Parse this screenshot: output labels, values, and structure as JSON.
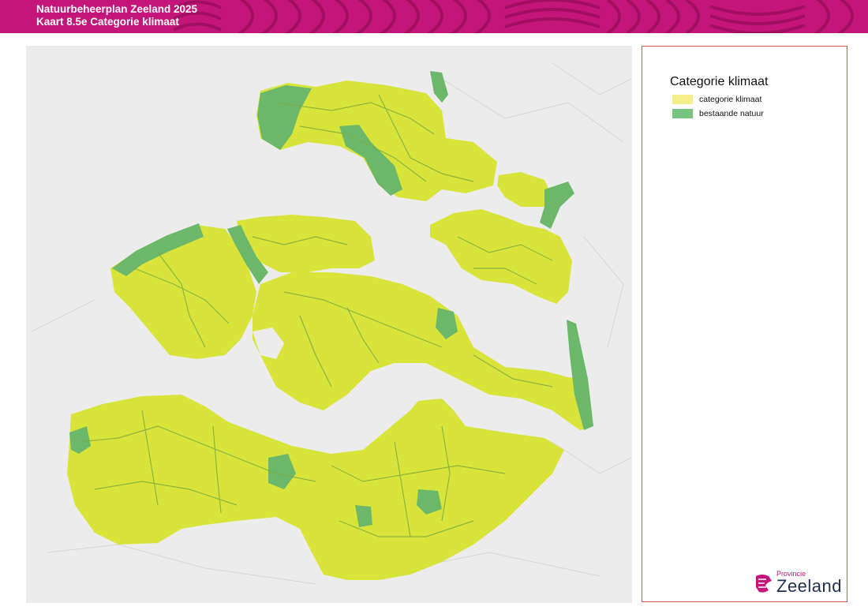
{
  "header": {
    "line1": "Natuurbeheerplan Zeeland 2025",
    "line2": "Kaart 8.5e Categorie klimaat",
    "color": "#c4157a"
  },
  "legend": {
    "title": "Categorie klimaat",
    "items": [
      {
        "label": "categorie klimaat",
        "color": "#f5ec8a"
      },
      {
        "label": "bestaande natuur",
        "color": "#78c47e"
      }
    ]
  },
  "map": {
    "colors": {
      "climate_area": "#d8e43a",
      "existing_nature": "#6cb86a",
      "water_land_background": "#ececec"
    }
  },
  "logo": {
    "small": "Provincie",
    "big": "Zeeland",
    "icon": "zeeland-lion-icon"
  }
}
